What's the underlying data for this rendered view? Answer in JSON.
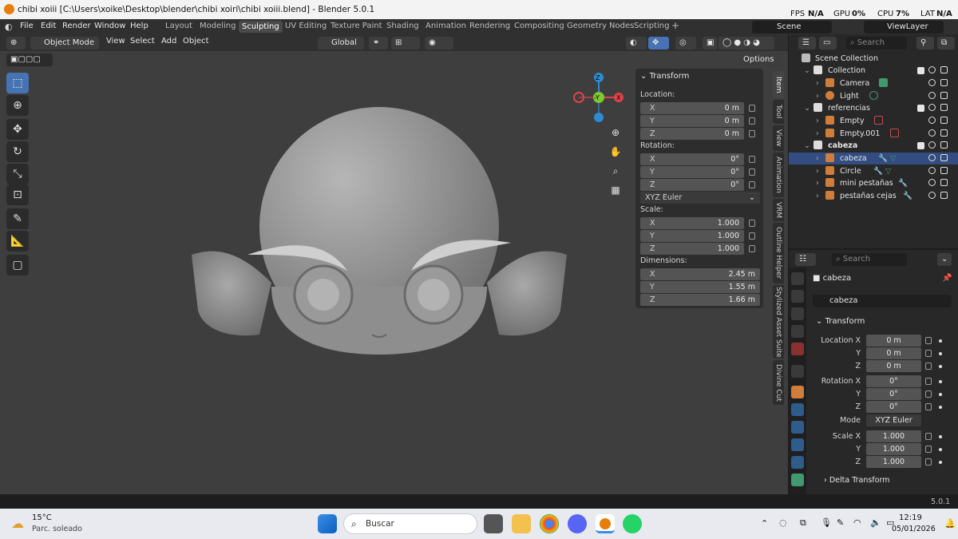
{
  "titlebar": {
    "title": "chibi xoiii [C:\\Users\\xoike\\Desktop\\blender\\chibi xoiri\\chibi xoiii.blend] - Blender 5.0.1",
    "fps_label": "FPS",
    "fps_val": "N/A",
    "gpu_label": "GPU",
    "gpu_val": "0%",
    "cpu_label": "CPU",
    "cpu_val": "7%",
    "lat_label": "LAT",
    "lat_val": "N/A"
  },
  "menu": {
    "items": [
      "File",
      "Edit",
      "Render",
      "Window",
      "Help"
    ],
    "workspaces": [
      "Layout",
      "Modeling",
      "Sculpting",
      "UV Editing",
      "Texture Paint",
      "Shading",
      "Animation",
      "Rendering",
      "Compositing",
      "Geometry Nodes",
      "Scripting"
    ],
    "active_workspace": "Sculpting",
    "add": "+",
    "scene": "Scene",
    "viewlayer": "ViewLayer"
  },
  "header3d": {
    "mode": "Object Mode",
    "view": "View",
    "select": "Select",
    "add": "Add",
    "object": "Object",
    "orientation": "Global",
    "options": "Options"
  },
  "gizmo": {
    "z": "Z",
    "y": "-Y",
    "x": "X"
  },
  "npanel": {
    "title": "Transform",
    "location_label": "Location:",
    "location": [
      {
        "axis": "X",
        "val": "0 m"
      },
      {
        "axis": "Y",
        "val": "0 m"
      },
      {
        "axis": "Z",
        "val": "0 m"
      }
    ],
    "rotation_label": "Rotation:",
    "rotation": [
      {
        "axis": "X",
        "val": "0°"
      },
      {
        "axis": "Y",
        "val": "0°"
      },
      {
        "axis": "Z",
        "val": "0°"
      }
    ],
    "rotation_mode": "XYZ Euler",
    "scale_label": "Scale:",
    "scale": [
      {
        "axis": "X",
        "val": "1.000"
      },
      {
        "axis": "Y",
        "val": "1.000"
      },
      {
        "axis": "Z",
        "val": "1.000"
      }
    ],
    "dimensions_label": "Dimensions:",
    "dimensions": [
      {
        "axis": "X",
        "val": "2.45 m"
      },
      {
        "axis": "Y",
        "val": "1.55 m"
      },
      {
        "axis": "Z",
        "val": "1.66 m"
      }
    ],
    "tabs": [
      "Item",
      "Tool",
      "View",
      "Animation",
      "VRM",
      "Outline Helper",
      "Stylized Asset Suite",
      "Divine Cut"
    ]
  },
  "outliner": {
    "search_placeholder": "Search",
    "root": "Scene Collection",
    "rows": [
      {
        "name": "Collection",
        "type": "collection"
      },
      {
        "name": "Camera",
        "type": "camera"
      },
      {
        "name": "Light",
        "type": "light"
      },
      {
        "name": "referencias",
        "type": "collection"
      },
      {
        "name": "Empty",
        "type": "empty"
      },
      {
        "name": "Empty.001",
        "type": "empty"
      },
      {
        "name": "cabeza",
        "type": "collection"
      },
      {
        "name": "cabeza",
        "type": "mesh"
      },
      {
        "name": "Circle",
        "type": "mesh"
      },
      {
        "name": "mini pestañas",
        "type": "mesh"
      },
      {
        "name": "pestañas cejas",
        "type": "mesh"
      }
    ]
  },
  "props": {
    "search_placeholder": "Search",
    "object": "cabeza",
    "object_field": "cabeza",
    "section": "Transform",
    "loc_label": "Location X",
    "loc": [
      "0 m",
      "0 m",
      "0 m"
    ],
    "rot_label": "Rotation X",
    "rot": [
      "0°",
      "0°",
      "0°"
    ],
    "mode_label": "Mode",
    "mode": "XYZ Euler",
    "scale_label": "Scale X",
    "scale": [
      "1.000",
      "1.000",
      "1.000"
    ],
    "y": "Y",
    "z": "Z",
    "delta": "Delta Transform"
  },
  "status": {
    "version": "5.0.1"
  },
  "taskbar": {
    "temp": "15°C",
    "weather": "Parc. soleado",
    "search": "Buscar",
    "time": "12:19",
    "date": "05/01/2026"
  },
  "colors": {
    "accent": "#4772b3",
    "selected_row": "#334d80",
    "gizmo_x": "#e0434b",
    "gizmo_y": "#7ec731",
    "gizmo_z": "#2e8bd1"
  }
}
